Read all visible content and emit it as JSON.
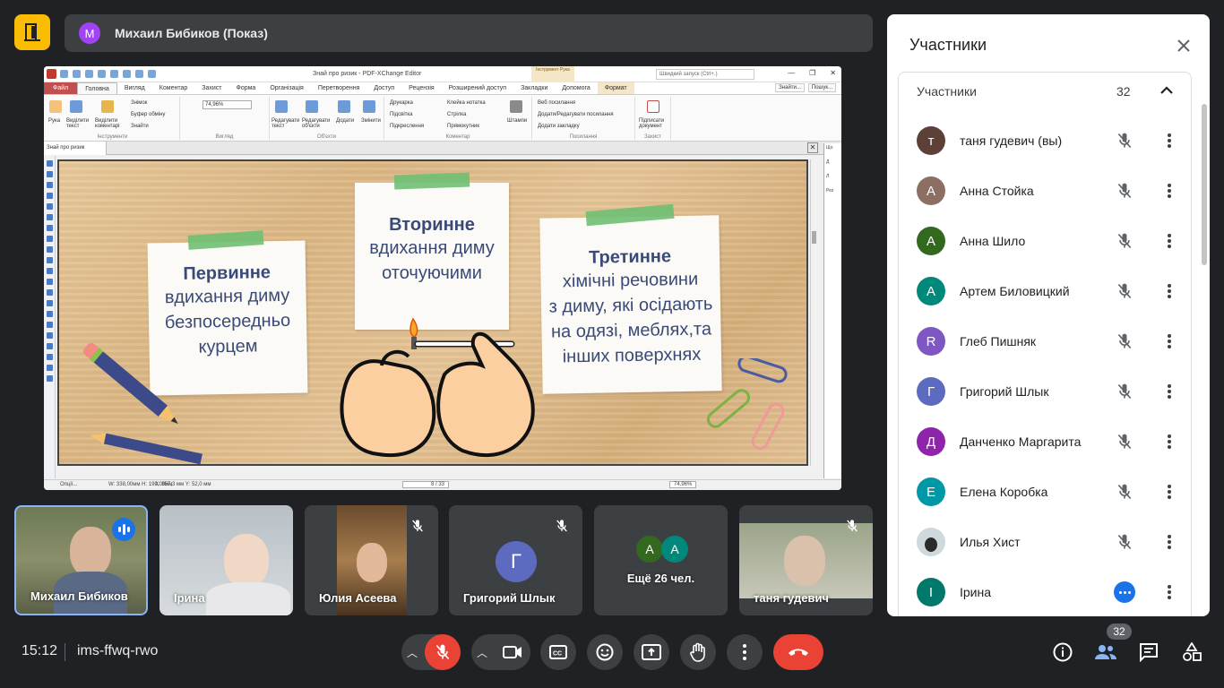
{
  "meeting": {
    "presenter_initial": "М",
    "presenter_label": "Михаил Бибиков (Показ)",
    "time": "15:12",
    "code": "ims-ffwq-rwo",
    "people_badge": "32"
  },
  "app": {
    "title": "Знай про ризик - PDF-XChange Editor",
    "quick_search": "Швидкий запуск (Ctrl+.)",
    "context_tab": "Інструмент Рука",
    "menu": [
      "Файл",
      "Головна",
      "Вигляд",
      "Коментар",
      "Захист",
      "Форма",
      "Організація",
      "Перетворення",
      "Доступ",
      "Рецензія",
      "Розширений доступ",
      "Закладки",
      "Допомога",
      "Формат"
    ],
    "menu_right": [
      "Знайти...",
      "Пошук..."
    ],
    "zoom": "74,96%",
    "ribbon": {
      "hand": "Рука",
      "select_text": "Виділити текст",
      "select_comments": "Виділити коментарі",
      "snapshot": "Знімок",
      "clipboard": "Буфер обміну",
      "find": "Знайти",
      "group_tools": "Інструменти",
      "group_view": "Вигляд",
      "edit_text": "Редагувати текст",
      "edit_objects": "Редагувати об'єкти",
      "add": "Додати",
      "change": "Змінити",
      "group_objects": "Об'єкти",
      "typewriter": "Друкарка",
      "highlight": "Підсвітка",
      "strikeout": "Підкреслення",
      "sticky": "Клейка нотатка",
      "arrow": "Стрілка",
      "rectangle": "Прямокутник",
      "stamps": "Штампи",
      "group_comments": "Коментар",
      "web_links": "Веб посилання",
      "add_edit_links": "Додати/Редагувати посилання",
      "add_bookmark": "Додати закладку",
      "group_links": "Посилання",
      "sign": "Підписати документ",
      "group_protect": "Захист"
    },
    "doc_tab": "Знай про ризик",
    "right_panel": [
      "Що",
      "Д",
      "Л",
      "Рез"
    ],
    "status": {
      "options": "Опції...",
      "size": "W: 338,00мм  H: 190,00мм",
      "coords": "X: 357,3 мм  Y: 52,0 мм",
      "page": "8 / 33",
      "zoom": "74,96%"
    }
  },
  "slide": {
    "note1": {
      "title": "Первинне",
      "lines": [
        "вдихання диму",
        "безпосередньо",
        "курцем"
      ]
    },
    "note2": {
      "title": "Вторинне",
      "lines": [
        "вдихання диму",
        "оточуючими"
      ]
    },
    "note3": {
      "title": "Третинне",
      "lines": [
        "хімічні речовини",
        "з диму, які осідають",
        "на одязі, меблях,та",
        "інших поверхнях"
      ]
    }
  },
  "tiles": [
    {
      "name": "Михаил Бибиков",
      "state": "speaking"
    },
    {
      "name": "Ірина",
      "state": "none"
    },
    {
      "name": "Юлия Асеева",
      "state": "muted"
    },
    {
      "name": "Григорий Шлык",
      "state": "muted",
      "initial": "Г"
    },
    {
      "name": "Ещё 26 чел.",
      "state": "none",
      "initials": [
        "А",
        "А"
      ]
    },
    {
      "name": "таня гудевич",
      "state": "muted"
    }
  ],
  "panel": {
    "title": "Участники",
    "section_label": "Участники",
    "count": "32",
    "participants": [
      {
        "initial": "т",
        "name": "таня гудевич (вы)",
        "color": "#5d4037"
      },
      {
        "initial": "А",
        "name": "Анна Стойка",
        "color": "#8d6e63"
      },
      {
        "initial": "А",
        "name": "Анна Шило",
        "color": "#33691e"
      },
      {
        "initial": "А",
        "name": "Артем Биловицкий",
        "color": "#00897b"
      },
      {
        "initial": "R",
        "name": "Глеб Пишняк",
        "color": "#7e57c2"
      },
      {
        "initial": "Г",
        "name": "Григорий Шлык",
        "color": "#5c6bc0"
      },
      {
        "initial": "Д",
        "name": "Данченко Маргарита",
        "color": "#8e24aa"
      },
      {
        "initial": "Е",
        "name": "Елена Коробка",
        "color": "#0097a7"
      },
      {
        "initial": "",
        "name": "Илья Хист",
        "color": "#cfd8dc"
      },
      {
        "initial": "І",
        "name": "Ірина",
        "color": "#00796b"
      }
    ]
  }
}
